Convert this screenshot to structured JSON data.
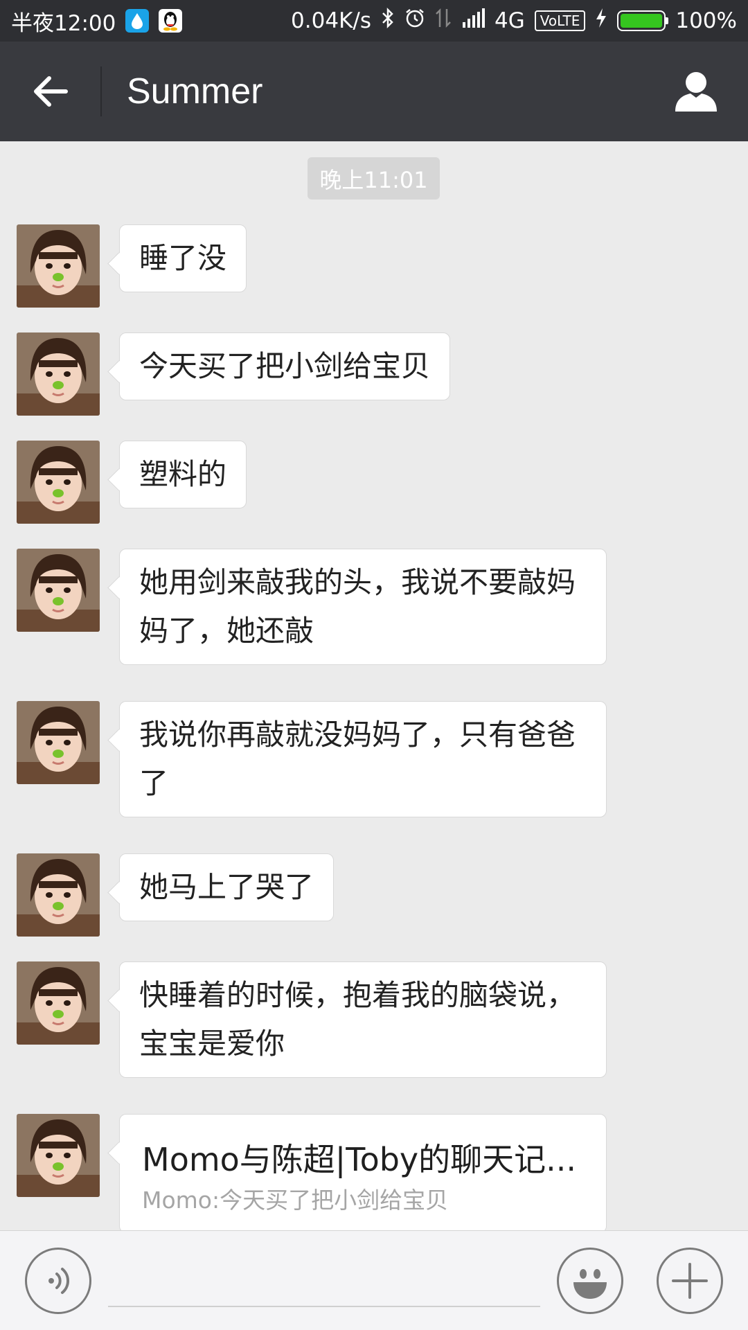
{
  "status_bar": {
    "time": "半夜12:00",
    "net_speed": "0.04K/s",
    "network": "4G",
    "volte": "VoLTE",
    "battery": "100%",
    "battery_level": 1.0,
    "icons": [
      "water-drop-icon",
      "qq-penguin-icon",
      "bluetooth-icon",
      "alarm-icon",
      "data-arrows-icon",
      "signal-icon",
      "charging-icon",
      "battery-icon"
    ]
  },
  "header": {
    "title": "Summer",
    "back_icon": "arrow-left-icon",
    "profile_icon": "person-icon"
  },
  "chat": {
    "timestamp": "晚上11:01",
    "messages": [
      {
        "text": "睡了没"
      },
      {
        "text": "今天买了把小剑给宝贝"
      },
      {
        "text": "塑料的"
      },
      {
        "text": "她用剑来敲我的头，我说不要敲妈妈了，她还敲"
      },
      {
        "text": "我说你再敲就没妈妈了，只有爸爸了"
      },
      {
        "text": "她马上了哭了"
      },
      {
        "text": "快睡着的时候，抱着我的脑袋说，宝宝是爱你"
      }
    ],
    "card": {
      "title": "Momo与陈超|Toby的聊天记...",
      "desc": "Momo:今天买了把小剑给宝贝"
    }
  },
  "input_bar": {
    "voice_icon": "voice-icon",
    "emoji_icon": "smiley-icon",
    "plus_icon": "plus-icon"
  },
  "colors": {
    "header_bg": "#393a3f",
    "chat_bg": "#ebebeb",
    "bubble_bg": "#ffffff",
    "battery_green": "#35c61f"
  }
}
